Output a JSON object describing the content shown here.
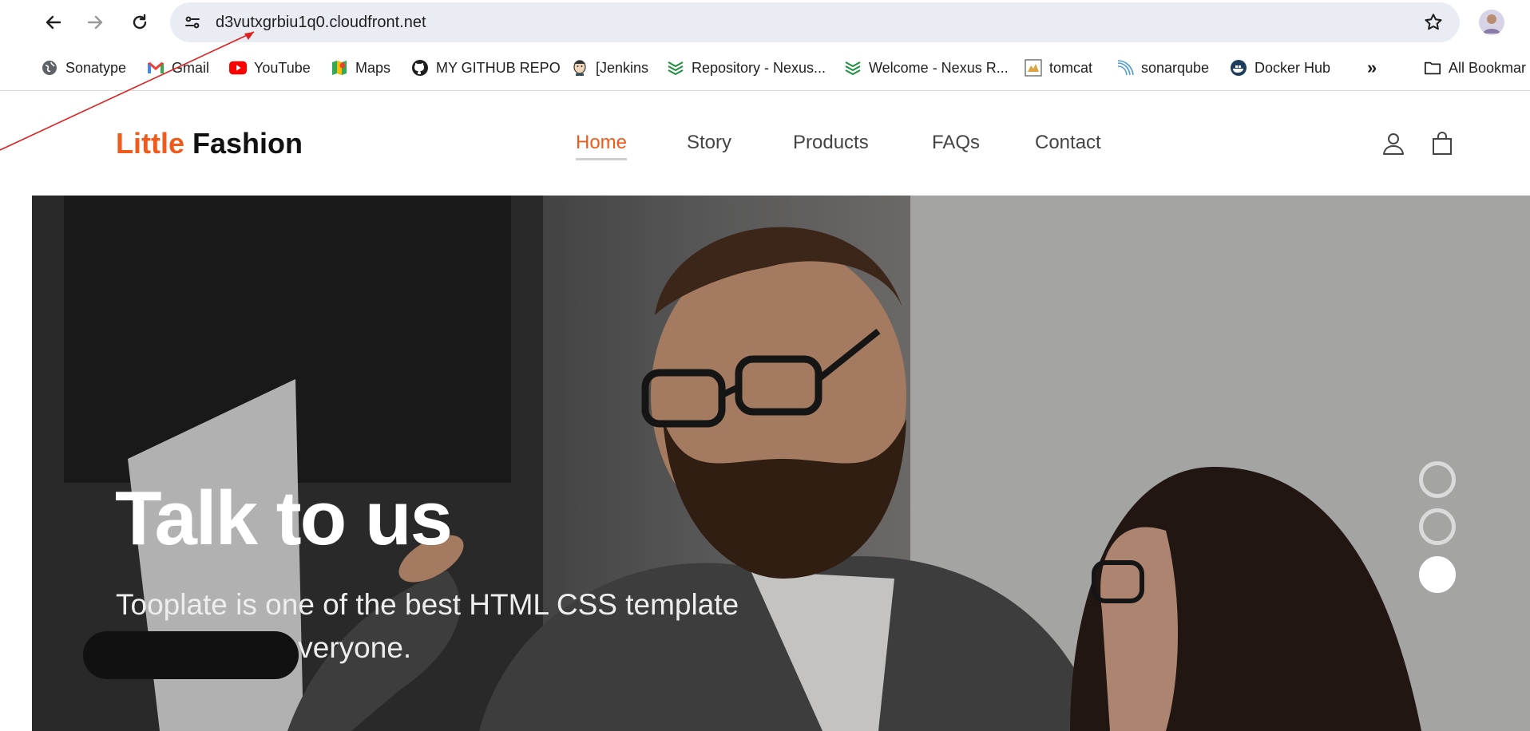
{
  "browser": {
    "url": "d3vutxgrbiu1q0.cloudfront.net",
    "icons": [
      "back-icon",
      "forward-icon",
      "reload-icon",
      "site-settings-icon",
      "bookmark-star-icon",
      "profile-avatar"
    ]
  },
  "bookmarks": {
    "items": [
      {
        "label": "Sonatype",
        "icon": "globe-icon"
      },
      {
        "label": "Gmail",
        "icon": "gmail-icon"
      },
      {
        "label": "YouTube",
        "icon": "youtube-icon"
      },
      {
        "label": "Maps",
        "icon": "maps-icon"
      },
      {
        "label": "MY GITHUB REPO",
        "icon": "github-icon"
      },
      {
        "label": "[Jenkins",
        "icon": "jenkins-icon"
      },
      {
        "label": "Repository - Nexus...",
        "icon": "nexus-icon"
      },
      {
        "label": "Welcome - Nexus R...",
        "icon": "nexus-icon"
      },
      {
        "label": "tomcat",
        "icon": "tomcat-icon"
      },
      {
        "label": "sonarqube",
        "icon": "sonarqube-icon"
      },
      {
        "label": "Docker Hub",
        "icon": "docker-icon"
      }
    ],
    "overflow": "»",
    "all_bookmarks": "All Bookmar"
  },
  "site": {
    "brand_part1": "Little",
    "brand_part2": "Fashion",
    "nav": [
      {
        "label": "Home",
        "active": true
      },
      {
        "label": "Story",
        "active": false
      },
      {
        "label": "Products",
        "active": false
      },
      {
        "label": "FAQs",
        "active": false
      },
      {
        "label": "Contact",
        "active": false
      }
    ],
    "header_icons": [
      "user-icon",
      "shopping-bag-icon"
    ]
  },
  "hero": {
    "title": "Talk to us",
    "subtitle": "Tooplate is one of the best HTML CSS template websites for everyone.",
    "slide_count": 3,
    "active_slide": 3
  },
  "colors": {
    "accent": "#f05a1a",
    "omnibox": "#e9ecf3",
    "annotation": "#e02020"
  }
}
